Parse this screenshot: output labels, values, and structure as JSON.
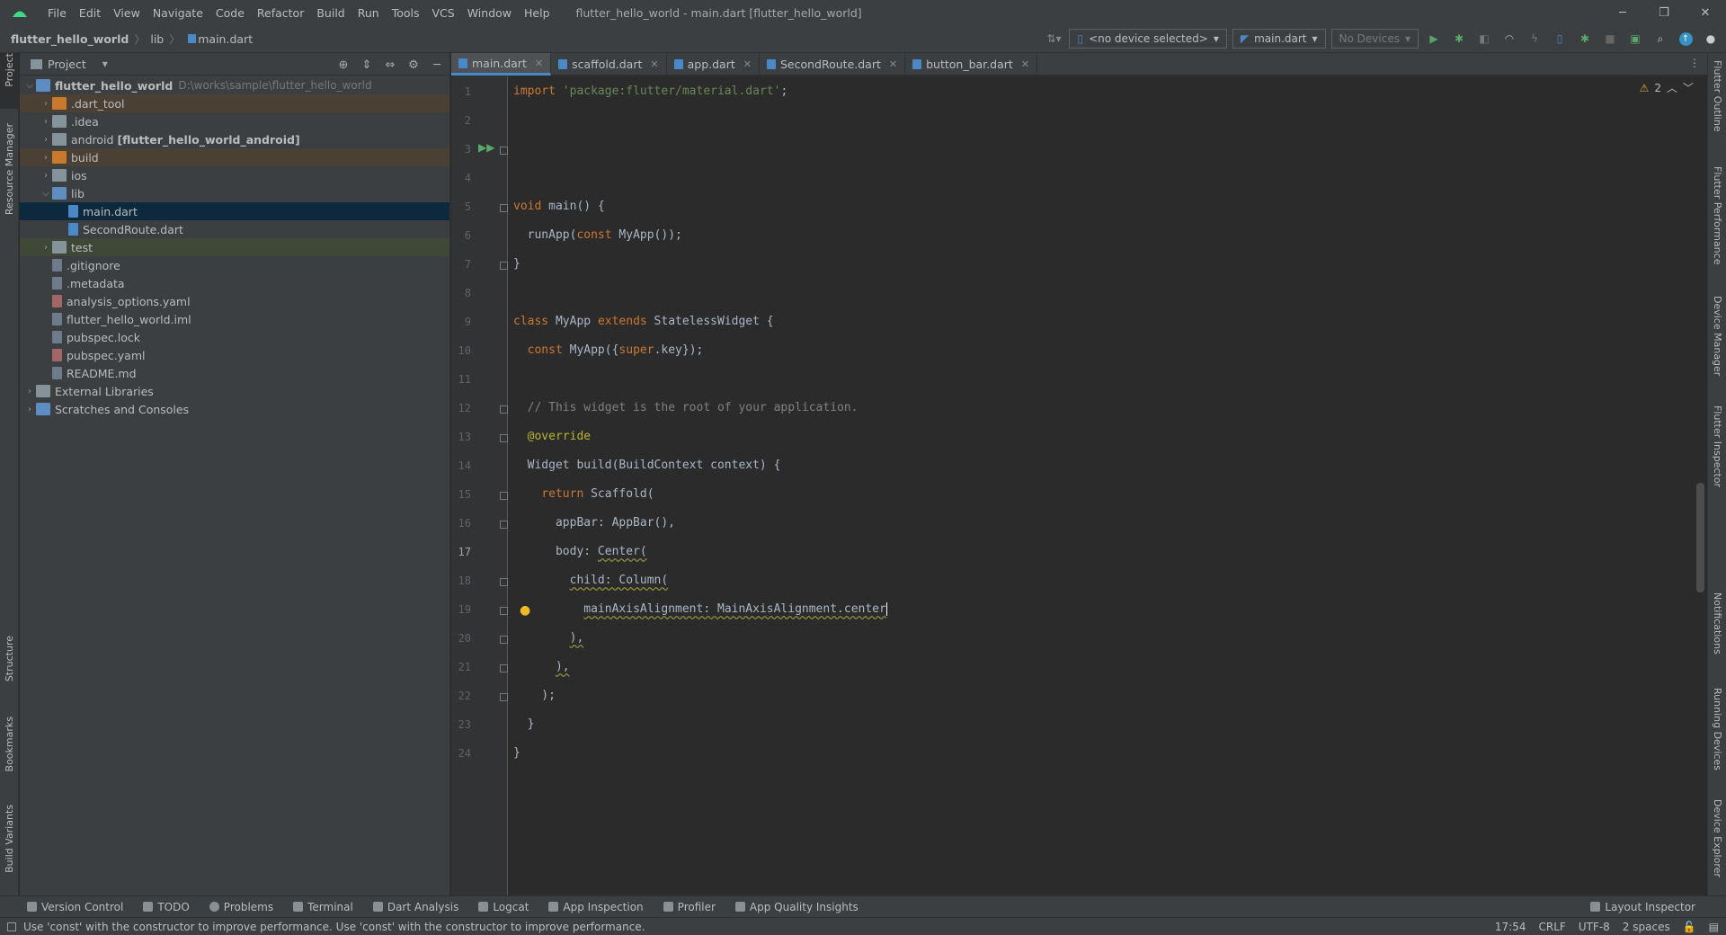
{
  "menubar": {
    "items": [
      "File",
      "Edit",
      "View",
      "Navigate",
      "Code",
      "Refactor",
      "Build",
      "Run",
      "Tools",
      "VCS",
      "Window",
      "Help"
    ],
    "window_title": "flutter_hello_world - main.dart [flutter_hello_world]"
  },
  "navbar": {
    "crumbs": [
      "flutter_hello_world",
      "lib",
      "main.dart"
    ],
    "device_combo": "<no device selected>",
    "run_config": "main.dart",
    "devices_combo": "No Devices"
  },
  "project_panel": {
    "title": "Project",
    "tree": [
      {
        "label": "flutter_hello_world",
        "path": "D:\\works\\sample\\flutter_hello_world",
        "depth": 0,
        "open": true,
        "kind": "module"
      },
      {
        "label": ".dart_tool",
        "depth": 1,
        "kind": "folder-orange",
        "hl": "orange"
      },
      {
        "label": ".idea",
        "depth": 1,
        "kind": "folder"
      },
      {
        "label": "android",
        "suffix": "[flutter_hello_world_android]",
        "depth": 1,
        "kind": "folder"
      },
      {
        "label": "build",
        "depth": 1,
        "kind": "folder-orange",
        "hl": "orange"
      },
      {
        "label": "ios",
        "depth": 1,
        "kind": "folder"
      },
      {
        "label": "lib",
        "depth": 1,
        "kind": "folder-blue",
        "open": true
      },
      {
        "label": "main.dart",
        "depth": 2,
        "kind": "dart",
        "selected": true
      },
      {
        "label": "SecondRoute.dart",
        "depth": 2,
        "kind": "dart"
      },
      {
        "label": "test",
        "depth": 1,
        "kind": "folder",
        "hl": "green"
      },
      {
        "label": ".gitignore",
        "depth": 1,
        "kind": "file"
      },
      {
        "label": ".metadata",
        "depth": 1,
        "kind": "file"
      },
      {
        "label": "analysis_options.yaml",
        "depth": 1,
        "kind": "yaml"
      },
      {
        "label": "flutter_hello_world.iml",
        "depth": 1,
        "kind": "file"
      },
      {
        "label": "pubspec.lock",
        "depth": 1,
        "kind": "file"
      },
      {
        "label": "pubspec.yaml",
        "depth": 1,
        "kind": "yaml"
      },
      {
        "label": "README.md",
        "depth": 1,
        "kind": "file"
      },
      {
        "label": "External Libraries",
        "depth": 0,
        "kind": "lib"
      },
      {
        "label": "Scratches and Consoles",
        "depth": 0,
        "kind": "scratch"
      }
    ]
  },
  "left_tool_tabs": [
    "Project",
    "Resource Manager",
    "Structure",
    "Bookmarks",
    "Build Variants"
  ],
  "right_tool_tabs": [
    "Flutter Outline",
    "Flutter Performance",
    "Device Manager",
    "Flutter Inspector",
    "Notifications",
    "Running Devices",
    "Device Explorer"
  ],
  "editor_tabs": [
    "main.dart",
    "scaffold.dart",
    "app.dart",
    "SecondRoute.dart",
    "button_bar.dart"
  ],
  "editor": {
    "warning_count": "2",
    "current_line": 17,
    "line_numbers": [
      "1",
      "2",
      "3",
      "4",
      "5",
      "6",
      "7",
      "8",
      "9",
      "10",
      "11",
      "12",
      "13",
      "14",
      "15",
      "16",
      "17",
      "18",
      "19",
      "20",
      "21",
      "22",
      "23",
      "24"
    ]
  },
  "bottom_tools": [
    "Version Control",
    "TODO",
    "Problems",
    "Terminal",
    "Dart Analysis",
    "Logcat",
    "App Inspection",
    "Profiler",
    "App Quality Insights"
  ],
  "layout_inspector": "Layout Inspector",
  "status": {
    "message": "Use 'const' with the constructor to improve performance. Use 'const' with the constructor to improve performance.",
    "position": "17:54",
    "line_sep": "CRLF",
    "encoding": "UTF-8",
    "indent": "2 spaces"
  },
  "colors": {
    "background": "#2b2b2b",
    "panel": "#3c3f41",
    "keyword": "#cc7832",
    "string": "#6a8759",
    "comment": "#808080",
    "annotation": "#bbb529",
    "selection": "#0d293e"
  }
}
